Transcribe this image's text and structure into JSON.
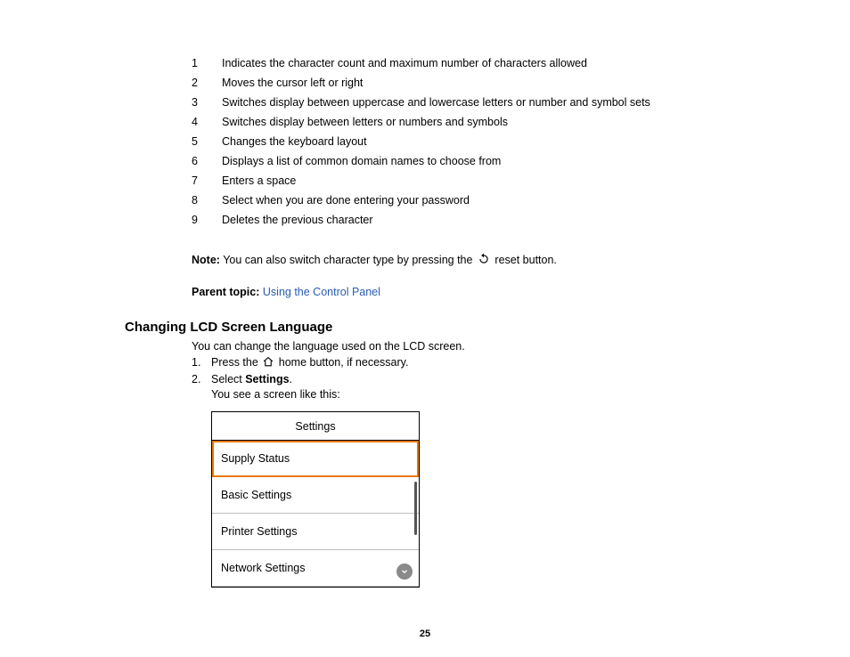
{
  "legend": [
    {
      "n": "1",
      "t": "Indicates the character count and maximum number of characters allowed"
    },
    {
      "n": "2",
      "t": "Moves the cursor left or right"
    },
    {
      "n": "3",
      "t": "Switches display between uppercase and lowercase letters or number and symbol sets"
    },
    {
      "n": "4",
      "t": "Switches display between letters or numbers and symbols"
    },
    {
      "n": "5",
      "t": "Changes the keyboard layout"
    },
    {
      "n": "6",
      "t": "Displays a list of common domain names to choose from"
    },
    {
      "n": "7",
      "t": "Enters a space"
    },
    {
      "n": "8",
      "t": "Select when you are done entering your password"
    },
    {
      "n": "9",
      "t": "Deletes the previous character"
    }
  ],
  "note": {
    "label": "Note:",
    "before": " You can also switch character type by pressing the ",
    "after": " reset button."
  },
  "parent": {
    "label": "Parent topic:",
    "link": "Using the Control Panel"
  },
  "heading": "Changing LCD Screen Language",
  "intro": "You can change the language used on the LCD screen.",
  "steps": {
    "s1n": "1.",
    "s1a": "Press the ",
    "s1b": " home button, if necessary.",
    "s2n": "2.",
    "s2a": "Select ",
    "s2b": "Settings",
    "s2c": ".",
    "sub": "You see a screen like this:"
  },
  "lcd": {
    "title": "Settings",
    "items": [
      "Supply Status",
      "Basic Settings",
      "Printer Settings",
      "Network Settings"
    ]
  },
  "pagenum": "25"
}
